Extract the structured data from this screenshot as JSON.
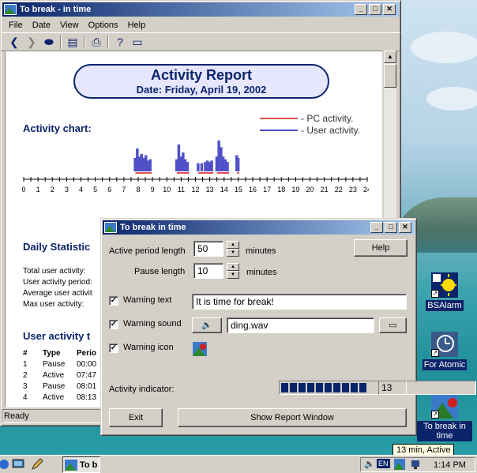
{
  "main_window": {
    "title": "To break - in time",
    "menu": [
      "File",
      "Date",
      "View",
      "Options",
      "Help"
    ],
    "status": "Ready"
  },
  "report": {
    "title": "Activity Report",
    "date_line": "Date: Friday, April 19, 2002",
    "activity_chart_heading": "Activity chart:",
    "legend": [
      {
        "label": "- PC activity.",
        "color": "#e05050"
      },
      {
        "label": "- User activity.",
        "color": "#5050c8"
      }
    ],
    "daily_heading": "Daily Statistic",
    "stats": [
      "Total user activity:",
      "User activity period:",
      "Average user activit",
      "Max user activity:"
    ],
    "table_heading": "User activity t",
    "table": {
      "headers": [
        "#",
        "Type",
        "Perio"
      ],
      "rows": [
        [
          "1",
          "Pause",
          "00:00"
        ],
        [
          "2",
          "Active",
          "07:47"
        ],
        [
          "3",
          "Pause",
          "08:01"
        ],
        [
          "4",
          "Active",
          "08:13"
        ]
      ]
    }
  },
  "chart_data": {
    "type": "bar",
    "xlabel": "",
    "ylabel": "",
    "xlim": [
      0,
      24
    ],
    "ticks": [
      "0",
      "1",
      "2",
      "3",
      "4",
      "5",
      "6",
      "7",
      "8",
      "9",
      "10",
      "11",
      "12",
      "13",
      "14",
      "15",
      "16",
      "17",
      "18",
      "19",
      "20",
      "21",
      "22",
      "23",
      "24"
    ],
    "series": [
      {
        "name": "- User activity.",
        "color": "#5050c8",
        "points": [
          [
            7.8,
            0.5
          ],
          [
            7.95,
            0.85
          ],
          [
            8.1,
            0.55
          ],
          [
            8.25,
            0.65
          ],
          [
            8.4,
            0.5
          ],
          [
            8.55,
            0.6
          ],
          [
            8.7,
            0.4
          ],
          [
            8.85,
            0.45
          ],
          [
            10.7,
            0.45
          ],
          [
            10.85,
            1.0
          ],
          [
            11.0,
            0.55
          ],
          [
            11.15,
            0.7
          ],
          [
            11.3,
            0.45
          ],
          [
            11.45,
            0.35
          ],
          [
            12.2,
            0.3
          ],
          [
            12.45,
            0.3
          ],
          [
            12.7,
            0.35
          ],
          [
            12.85,
            0.4
          ],
          [
            13.0,
            0.35
          ],
          [
            13.15,
            0.4
          ],
          [
            13.5,
            0.55
          ],
          [
            13.65,
            1.15
          ],
          [
            13.8,
            0.9
          ],
          [
            13.95,
            0.55
          ],
          [
            14.1,
            0.45
          ],
          [
            14.25,
            0.35
          ],
          [
            14.9,
            0.6
          ],
          [
            15.0,
            0.5
          ]
        ]
      },
      {
        "name": "- PC activity.",
        "color": "#e05050",
        "segments": [
          [
            7.8,
            8.95
          ],
          [
            10.7,
            11.55
          ],
          [
            12.2,
            13.25
          ],
          [
            13.5,
            14.35
          ],
          [
            14.9,
            15.05
          ]
        ]
      }
    ]
  },
  "dialog": {
    "title": "To break in time",
    "active_label": "Active period length",
    "active_value": "50",
    "active_unit": "minutes",
    "pause_label": "Pause length",
    "pause_value": "10",
    "pause_unit": "minutes",
    "help_button": "Help",
    "warning_text_label": "Warning text",
    "warning_text_value": "It is time for break!",
    "warning_sound_label": "Warning sound",
    "warning_sound_value": "ding.wav",
    "warning_icon_label": "Warning icon",
    "checkmark": "✓",
    "activity_label": "Activity indicator:",
    "activity_fraction": 0.48,
    "activity_blocks": 10,
    "activity_value": "13",
    "exit_button": "Exit",
    "show_report_button": "Show Report Window"
  },
  "desktop_icons": [
    {
      "label": "BSAlarm"
    },
    {
      "label": "For Atomic"
    },
    {
      "label": "To break in time"
    }
  ],
  "taskbar": {
    "task_label": "To b",
    "lang": "EN",
    "clock": "1:14 PM",
    "tooltip": "13 min, Active"
  },
  "colors": {
    "titlebar": "#0a246a",
    "face": "#d4d0c8",
    "user_activity": "#5050c8",
    "pc_activity": "#e05050"
  }
}
